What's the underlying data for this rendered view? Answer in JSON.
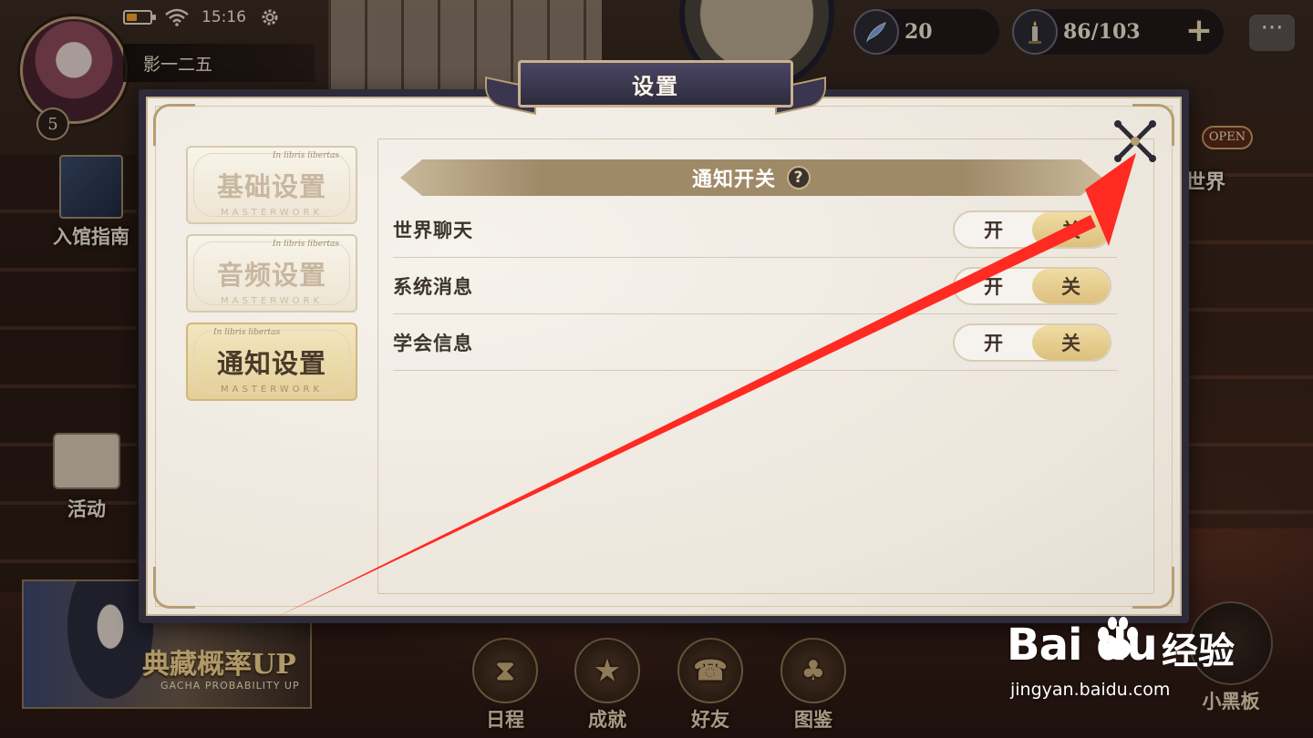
{
  "status_bar": {
    "time": "15:16",
    "battery_level": 0.45
  },
  "player": {
    "name": "影一二五",
    "level": "5"
  },
  "resources": {
    "feather": "20",
    "candle": "86/103",
    "add": "+"
  },
  "chat_glyph": "···",
  "side_nav": {
    "guide": "入馆指南",
    "activity": "活动",
    "world": "世界",
    "open_sign": "OPEN"
  },
  "banner": {
    "title": "典藏概率UP",
    "subtitle": "GACHA PROBABILITY UP"
  },
  "bottom_nav": [
    {
      "label": "日程"
    },
    {
      "label": "成就"
    },
    {
      "label": "好友"
    },
    {
      "label": "图鉴"
    }
  ],
  "blackboard": {
    "label": "小黑板"
  },
  "dialog": {
    "title": "设置",
    "tabs": [
      {
        "label": "基础设置",
        "small": "In libris libertas",
        "sub": "MASTERWORK",
        "active": false
      },
      {
        "label": "音频设置",
        "small": "In libris libertas",
        "sub": "MASTERWORK",
        "active": false
      },
      {
        "label": "通知设置",
        "small": "In libris libertas",
        "sub": "MASTERWORK",
        "active": true
      }
    ],
    "section_title": "通知开关",
    "help_glyph": "?",
    "rows": [
      {
        "label": "世界聊天",
        "on": "开",
        "off": "关",
        "state": "off"
      },
      {
        "label": "系统消息",
        "on": "开",
        "off": "关",
        "state": "off"
      },
      {
        "label": "学会信息",
        "on": "开",
        "off": "关",
        "state": "off"
      }
    ]
  },
  "watermark": {
    "logo": "Bai  du",
    "brand": "经验",
    "url": "jingyan.baidu.com"
  },
  "colors": {
    "annotation_arrow": "#ff2a22",
    "dialog_frame": "#2e2b3a",
    "accent_gold": "#c9b28a"
  }
}
